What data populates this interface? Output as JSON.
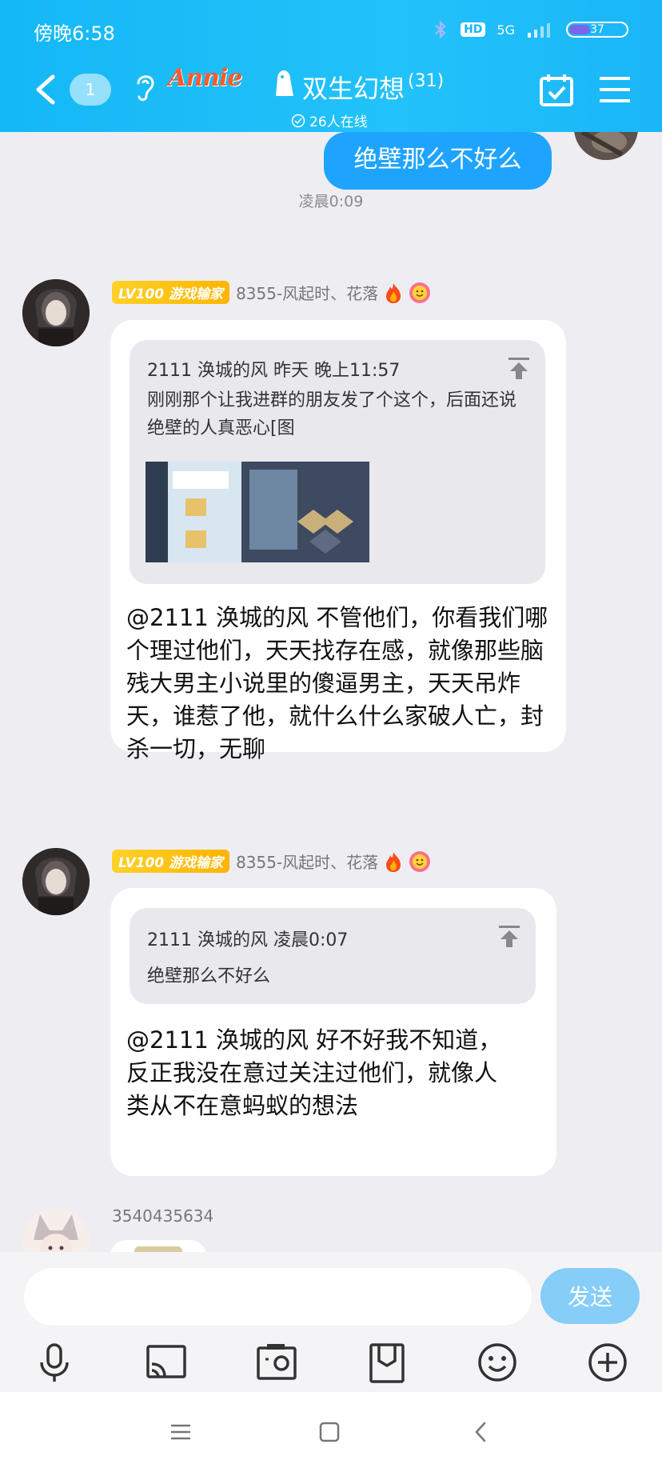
{
  "status_bar": {
    "time": "傍晚6:58",
    "network": "5G",
    "hd": "HD",
    "battery": "37",
    "battery_fraction": 0.37
  },
  "header": {
    "unread_count": "1",
    "logo_text": "Annie",
    "group_name": "双生幻想",
    "member_count": "(31)",
    "online_text": "26人在线"
  },
  "chat": {
    "my_message": "绝壁那么不好么",
    "time_separator": "凌晨0:09",
    "messages": [
      {
        "level_badge": "LV100 游戏输家",
        "sender": "8355-风起时、花落",
        "quote_author": "2111 涣城的风",
        "quote_time": "昨天 晚上11:57",
        "quote_text": "刚刚那个让我进群的朋友发了个这个，后面还说绝壁的人真恶心[图",
        "text": "@2111 涣城的风 不管他们，你看我们哪个理过他们，天天找存在感，就像那些脑残大男主小说里的傻逼男主，天天吊炸天，谁惹了他，就什么什么家破人亡，封杀一切，无聊"
      },
      {
        "level_badge": "LV100 游戏输家",
        "sender": "8355-风起时、花落",
        "quote_author": "2111 涣城的风",
        "quote_time": "凌晨0:07",
        "quote_text": "绝壁那么不好么",
        "text": "@2111 涣城的风 好不好我不知道，反正我没在意过关注过他们，就像人类从不在意蚂蚁的想法"
      }
    ],
    "third_sender": "3540435634"
  },
  "input": {
    "placeholder": "",
    "send_label": "发送"
  },
  "colors": {
    "header": "#1ab6f7",
    "my_bubble": "#1ea4ff",
    "level_badge": "#ffc21a",
    "send_button": "#86cdf8"
  },
  "icons": [
    "back-icon",
    "ear-icon",
    "calendar-check-icon",
    "menu-icon",
    "upload-icon",
    "microphone-icon",
    "cast-icon",
    "photo-icon",
    "mailbox-icon",
    "emoji-icon",
    "plus-icon",
    "nav-menu-icon",
    "nav-home-icon",
    "nav-back-icon"
  ]
}
